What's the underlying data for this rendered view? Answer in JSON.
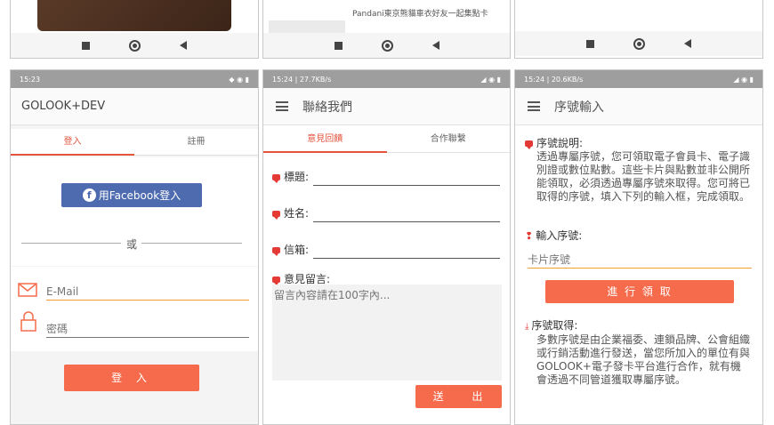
{
  "top_left": {},
  "top_middle": {
    "banner_caption": "Pandani東京熊貓車衣好友一起集點卡"
  },
  "top_right": {},
  "login_screen": {
    "status_time": "15:23",
    "app_title": "GOLOOK+DEV",
    "tabs": [
      "登入",
      "註冊"
    ],
    "facebook_button": "用Facebook登入",
    "divider_text": "或",
    "email_placeholder": "E-Mail",
    "password_placeholder": "密碼",
    "login_button": "登 入"
  },
  "contact_screen": {
    "status_time": "15:24 | 27.7KB/s",
    "title": "聯絡我們",
    "tabs": [
      "意見回饋",
      "合作聯繫"
    ],
    "subject_label": "標題:",
    "name_label": "姓名:",
    "email_label": "信箱:",
    "message_label": "意見留言:",
    "message_placeholder": "留言內容請在100字內...",
    "send_button": "送 出"
  },
  "serial_screen": {
    "status_time": "15:24 | 20.6KB/s",
    "title": "序號輸入",
    "desc_heading": "序號說明:",
    "desc_text": "透過專屬序號，您可領取電子會員卡、電子識別證或數位點數。這些卡片與點數並非公開所能領取，必須透過專屬序號來取得。您可將已取得的序號，填入下列的輸入框，完成領取。",
    "input_heading": "輸入序號:",
    "input_placeholder": "卡片序號",
    "submit_button": "進 行 領 取",
    "obtain_heading": "序號取得:",
    "obtain_text": "多數序號是由企業福委、連鎖品牌、公會組織或行銷活動進行發送，當您所加入的單位有與GOLOOK+電子發卡平台進行合作，就有機會透過不同管道獲取專屬序號。"
  },
  "colors": {
    "accent": "#f56b4c",
    "facebook": "#4e6bb0",
    "status_bar": "#9e9e9e"
  },
  "icons": [
    "menu-icon",
    "mail-icon",
    "lock-icon",
    "chat-bubble-icon",
    "pin-icon",
    "download-icon",
    "facebook-icon"
  ]
}
